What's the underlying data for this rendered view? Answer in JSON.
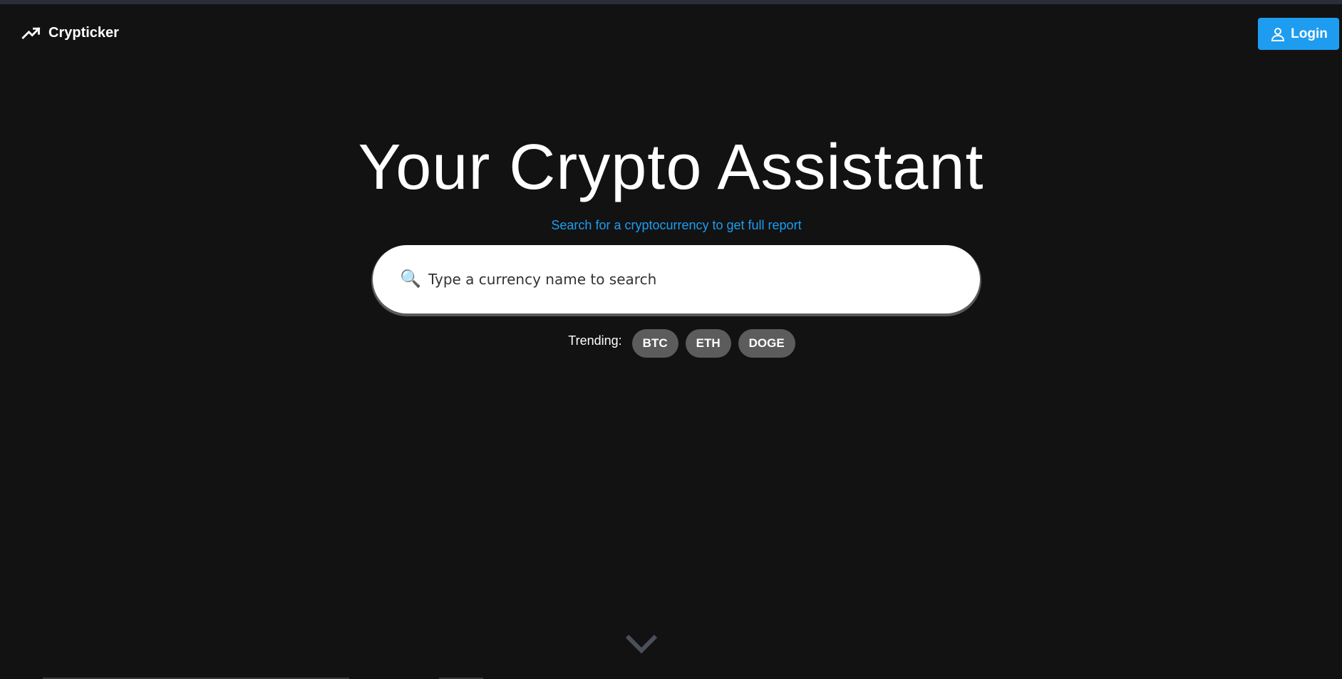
{
  "header": {
    "brand_name": "Crypticker",
    "brand_icon": "trending-up-icon",
    "login_label": "Login",
    "login_icon": "user-icon"
  },
  "hero": {
    "title": "Your Crypto Assistant",
    "subtitle": "Search for a cryptocurrency to get full report"
  },
  "search": {
    "icon": "🔍",
    "placeholder": "Type a currency name to search",
    "value": ""
  },
  "trending": {
    "label": "Trending:",
    "items": [
      "BTC",
      "ETH",
      "DOGE"
    ]
  },
  "scroll_icon": "chevron-down-icon",
  "colors": {
    "background": "#121212",
    "accent": "#1e9df0",
    "chip": "#5c5c5c",
    "chevron": "#4a5058"
  }
}
